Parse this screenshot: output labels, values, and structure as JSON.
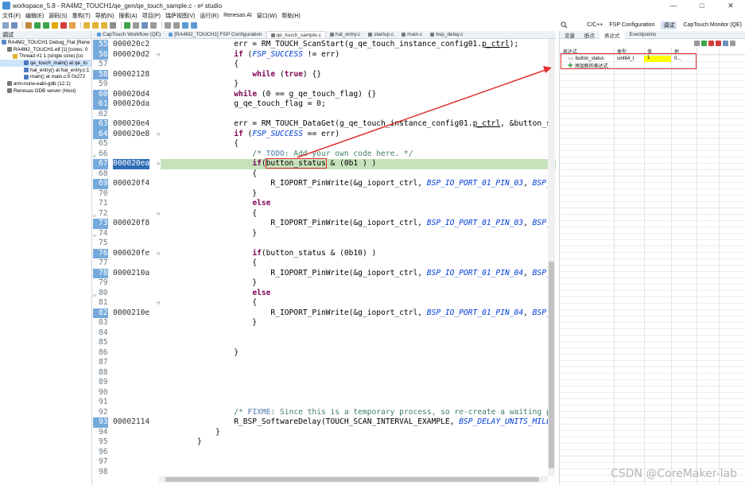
{
  "window": {
    "title": "workspace_5.8 - RA4M2_TOUCH1/qe_gen/qe_touch_sample.c - e² studio",
    "controls": [
      "—",
      "□",
      "✕"
    ]
  },
  "menu": [
    "文件(F)",
    "编辑(E)",
    "源码(S)",
    "重构(T)",
    "导航(N)",
    "搜索(A)",
    "项目(P)",
    "瑞萨视图(V)",
    "运行(R)",
    "Renesas AI",
    "窗口(W)",
    "帮助(H)"
  ],
  "perspectives": [
    "C/C++",
    "FSP Configuration",
    "调试",
    "CapTouch Monitor (QE)"
  ],
  "debug_pane": {
    "tab": "调试",
    "tree": [
      "RA4M2_TOUCH1 Debug_Flat [Rene",
      "RA4M2_TOUCH1.elf [1] [cores: 0",
      "Thread #1 1 (single core) [co",
      "qe_touch_main() at qe_to",
      "hal_entry() at hal_entry.c:1",
      "main() at main.c:5 0x272",
      "arm-none-eabi-gdb (12.1)",
      "Renesas GDB server (Host)"
    ]
  },
  "editor_tabs": [
    "CapTouch Workflow (QE)",
    "[RA4M2_TOUCH1] FSP Configuration",
    "qe_touch_sample.c",
    "hal_entry.c",
    "startup.c",
    "main.c",
    "bsp_delay.c"
  ],
  "code": {
    "current_address": "000020ea",
    "lines": [
      {
        "n": "55",
        "addr": "000020c2",
        "text": "        err = RM_TOUCH_ScanStart(g_qe_touch_instance_config01.p_ctrl);"
      },
      {
        "n": "56",
        "addr": "000020d2",
        "text": "        if (FSP_SUCCESS != err)"
      },
      {
        "n": "57",
        "addr": "",
        "text": "        {"
      },
      {
        "n": "58",
        "addr": "00002128",
        "text": "            while (true) {}"
      },
      {
        "n": "59",
        "addr": "",
        "text": "        }"
      },
      {
        "n": "60",
        "addr": "000020d4",
        "text": "        while (0 == g_qe_touch_flag) {}"
      },
      {
        "n": "61",
        "addr": "000020da",
        "text": "        g_qe_touch_flag = 0;"
      },
      {
        "n": "62",
        "addr": "",
        "text": ""
      },
      {
        "n": "63",
        "addr": "000020e4",
        "text": "        err = RM_TOUCH_DataGet(g_qe_touch_instance_config01.p_ctrl, &button_status, N"
      },
      {
        "n": "64",
        "addr": "000020e8",
        "text": "        if (FSP_SUCCESS == err)"
      },
      {
        "n": "65",
        "addr": "",
        "text": "        {"
      },
      {
        "n": "66",
        "addr": "",
        "text": "            /* TODO: Add your own code here. */"
      },
      {
        "n": "67",
        "addr": "000020ea",
        "text": "            if(button_status & (0b1 ) )"
      },
      {
        "n": "68",
        "addr": "",
        "text": "            {"
      },
      {
        "n": "69",
        "addr": "000020f4",
        "text": "                R_IOPORT_PinWrite(&g_ioport_ctrl, BSP_IO_PORT_01_PIN_03, BSP_IO_LEVEL"
      },
      {
        "n": "70",
        "addr": "",
        "text": "            }"
      },
      {
        "n": "71",
        "addr": "",
        "text": "            else"
      },
      {
        "n": "72",
        "addr": "",
        "text": "            {"
      },
      {
        "n": "73",
        "addr": "000020f8",
        "text": "                R_IOPORT_PinWrite(&g_ioport_ctrl, BSP_IO_PORT_01_PIN_03, BSP_IO_LEVEL"
      },
      {
        "n": "74",
        "addr": "",
        "text": "            }"
      },
      {
        "n": "75",
        "addr": "",
        "text": ""
      },
      {
        "n": "76",
        "addr": "000020fe",
        "text": "            if(button_status & (0b10) )"
      },
      {
        "n": "77",
        "addr": "",
        "text": "            {"
      },
      {
        "n": "78",
        "addr": "0000210a",
        "text": "                R_IOPORT_PinWrite(&g_ioport_ctrl, BSP_IO_PORT_01_PIN_04, BSP_IO_LEVEL"
      },
      {
        "n": "79",
        "addr": "",
        "text": "            }"
      },
      {
        "n": "80",
        "addr": "",
        "text": "            else"
      },
      {
        "n": "81",
        "addr": "",
        "text": "            {"
      },
      {
        "n": "82",
        "addr": "0000210e",
        "text": "                R_IOPORT_PinWrite(&g_ioport_ctrl, BSP_IO_PORT_01_PIN_04, BSP_IO_LEVEL"
      },
      {
        "n": "83",
        "addr": "",
        "text": "            }"
      },
      {
        "n": "84",
        "addr": "",
        "text": ""
      },
      {
        "n": "85",
        "addr": "",
        "text": ""
      },
      {
        "n": "86",
        "addr": "",
        "text": "        }"
      },
      {
        "n": "87",
        "addr": "",
        "text": ""
      },
      {
        "n": "88",
        "addr": "",
        "text": ""
      },
      {
        "n": "89",
        "addr": "",
        "text": ""
      },
      {
        "n": "90",
        "addr": "",
        "text": ""
      },
      {
        "n": "91",
        "addr": "",
        "text": ""
      },
      {
        "n": "92",
        "addr": "",
        "text": "        /* FIXME: Since this is a temporary process, so re-create a waiting process y"
      },
      {
        "n": "93",
        "addr": "00002114",
        "text": "        R_BSP_SoftwareDelay(TOUCH_SCAN_INTERVAL_EXAMPLE, BSP_DELAY_UNITS_MILLISECONDS"
      },
      {
        "n": "94",
        "addr": "",
        "text": "    }"
      },
      {
        "n": "95",
        "addr": "",
        "text": "}"
      },
      {
        "n": "96",
        "addr": "",
        "text": ""
      },
      {
        "n": "97",
        "addr": "",
        "text": ""
      },
      {
        "n": "98",
        "addr": "",
        "text": ""
      }
    ]
  },
  "right_pane": {
    "tabs": [
      "变量",
      "断点",
      "表达式",
      "Eventpoints"
    ],
    "headers": [
      "表达式",
      "类型",
      "值",
      "地"
    ],
    "expression": {
      "name": "button_status",
      "type": "uint64_t",
      "value": "1",
      "address": "0..."
    },
    "add_new": "添加新的表达式"
  },
  "watermark": "CSDN @CoreMaker-lab",
  "colors": {
    "highlight_red": "#e03030",
    "current_line": "#c6e2bb",
    "value_yellow": "#ffff00"
  }
}
